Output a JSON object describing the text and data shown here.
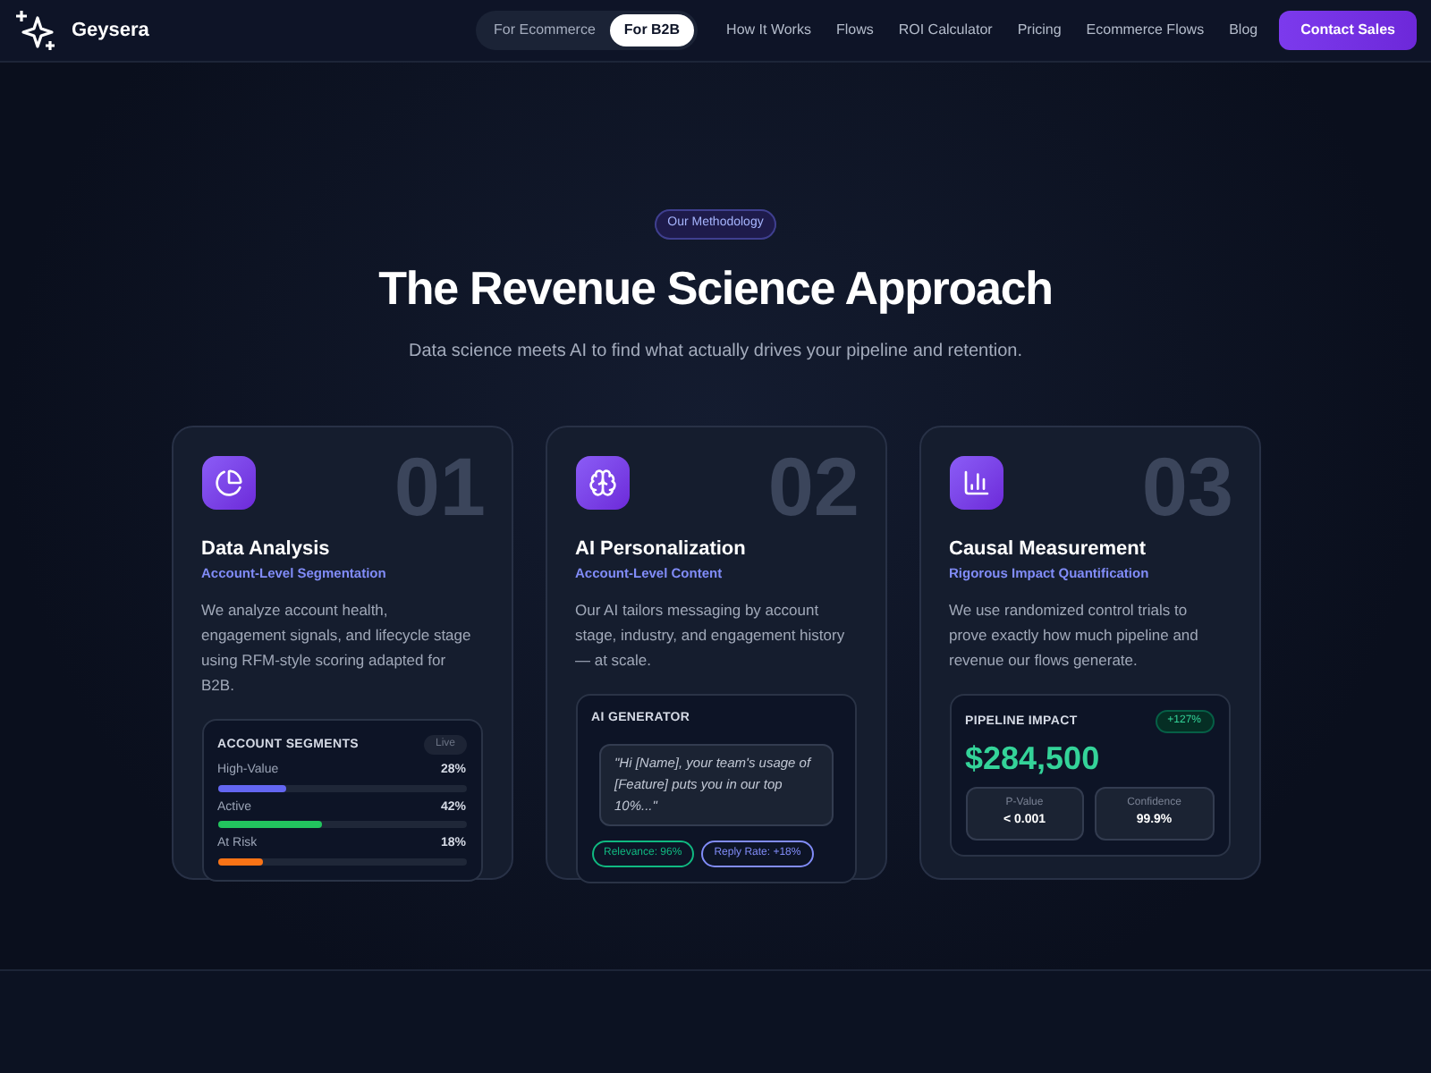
{
  "brand": {
    "name": "Geysera"
  },
  "audience_toggle": [
    {
      "label": "For Ecommerce",
      "selected": false
    },
    {
      "label": "For B2B",
      "selected": true
    }
  ],
  "nav_links": [
    "How It Works",
    "Flows",
    "ROI Calculator",
    "Pricing",
    "Ecommerce Flows",
    "Blog"
  ],
  "cta": "Contact Sales",
  "hero": {
    "badge": "Our Methodology",
    "title": "The Revenue Science Approach",
    "subtitle": "Data science meets AI to find what actually drives your pipeline and retention."
  },
  "cards": [
    {
      "number": "01",
      "title": "Data Analysis",
      "subtitle": "Account-Level Segmentation",
      "description": "We analyze account health, engagement signals, and lifecycle stage using RFM-style scoring adapted for B2B.",
      "widget": {
        "kind": "segments",
        "title": "ACCOUNT SEGMENTS",
        "badge": "Live",
        "rows": [
          {
            "label": "High-Value",
            "value": "28%",
            "level": 0.28,
            "color": "#6366f1"
          },
          {
            "label": "Active",
            "value": "42%",
            "level": 0.42,
            "color": "#22c55e"
          },
          {
            "label": "At Risk",
            "value": "18%",
            "level": 0.18,
            "color": "#f97316"
          }
        ]
      }
    },
    {
      "number": "02",
      "title": "AI Personalization",
      "subtitle": "Account-Level Content",
      "description": "Our AI tailors messaging by account stage, industry, and engagement history — at scale.",
      "widget": {
        "kind": "generator",
        "title": "AI GENERATOR",
        "quote": "\"Hi [Name], your team's usage of [Feature] puts you in our top 10%...\"",
        "chips": [
          {
            "label": "Relevance: 96%",
            "color": "#10b981"
          },
          {
            "label": "Reply Rate: +18%",
            "color": "#818cf8"
          }
        ]
      }
    },
    {
      "number": "03",
      "title": "Causal Measurement",
      "subtitle": "Rigorous Impact Quantification",
      "description": "We use randomized control trials to prove exactly how much pipeline and revenue our flows generate.",
      "widget": {
        "kind": "impact",
        "title": "PIPELINE IMPACT",
        "badge": "+127%",
        "value": "$284,500",
        "stats": [
          {
            "label": "P-Value",
            "value": "< 0.001"
          },
          {
            "label": "Confidence",
            "value": "99.9%"
          }
        ]
      }
    }
  ]
}
